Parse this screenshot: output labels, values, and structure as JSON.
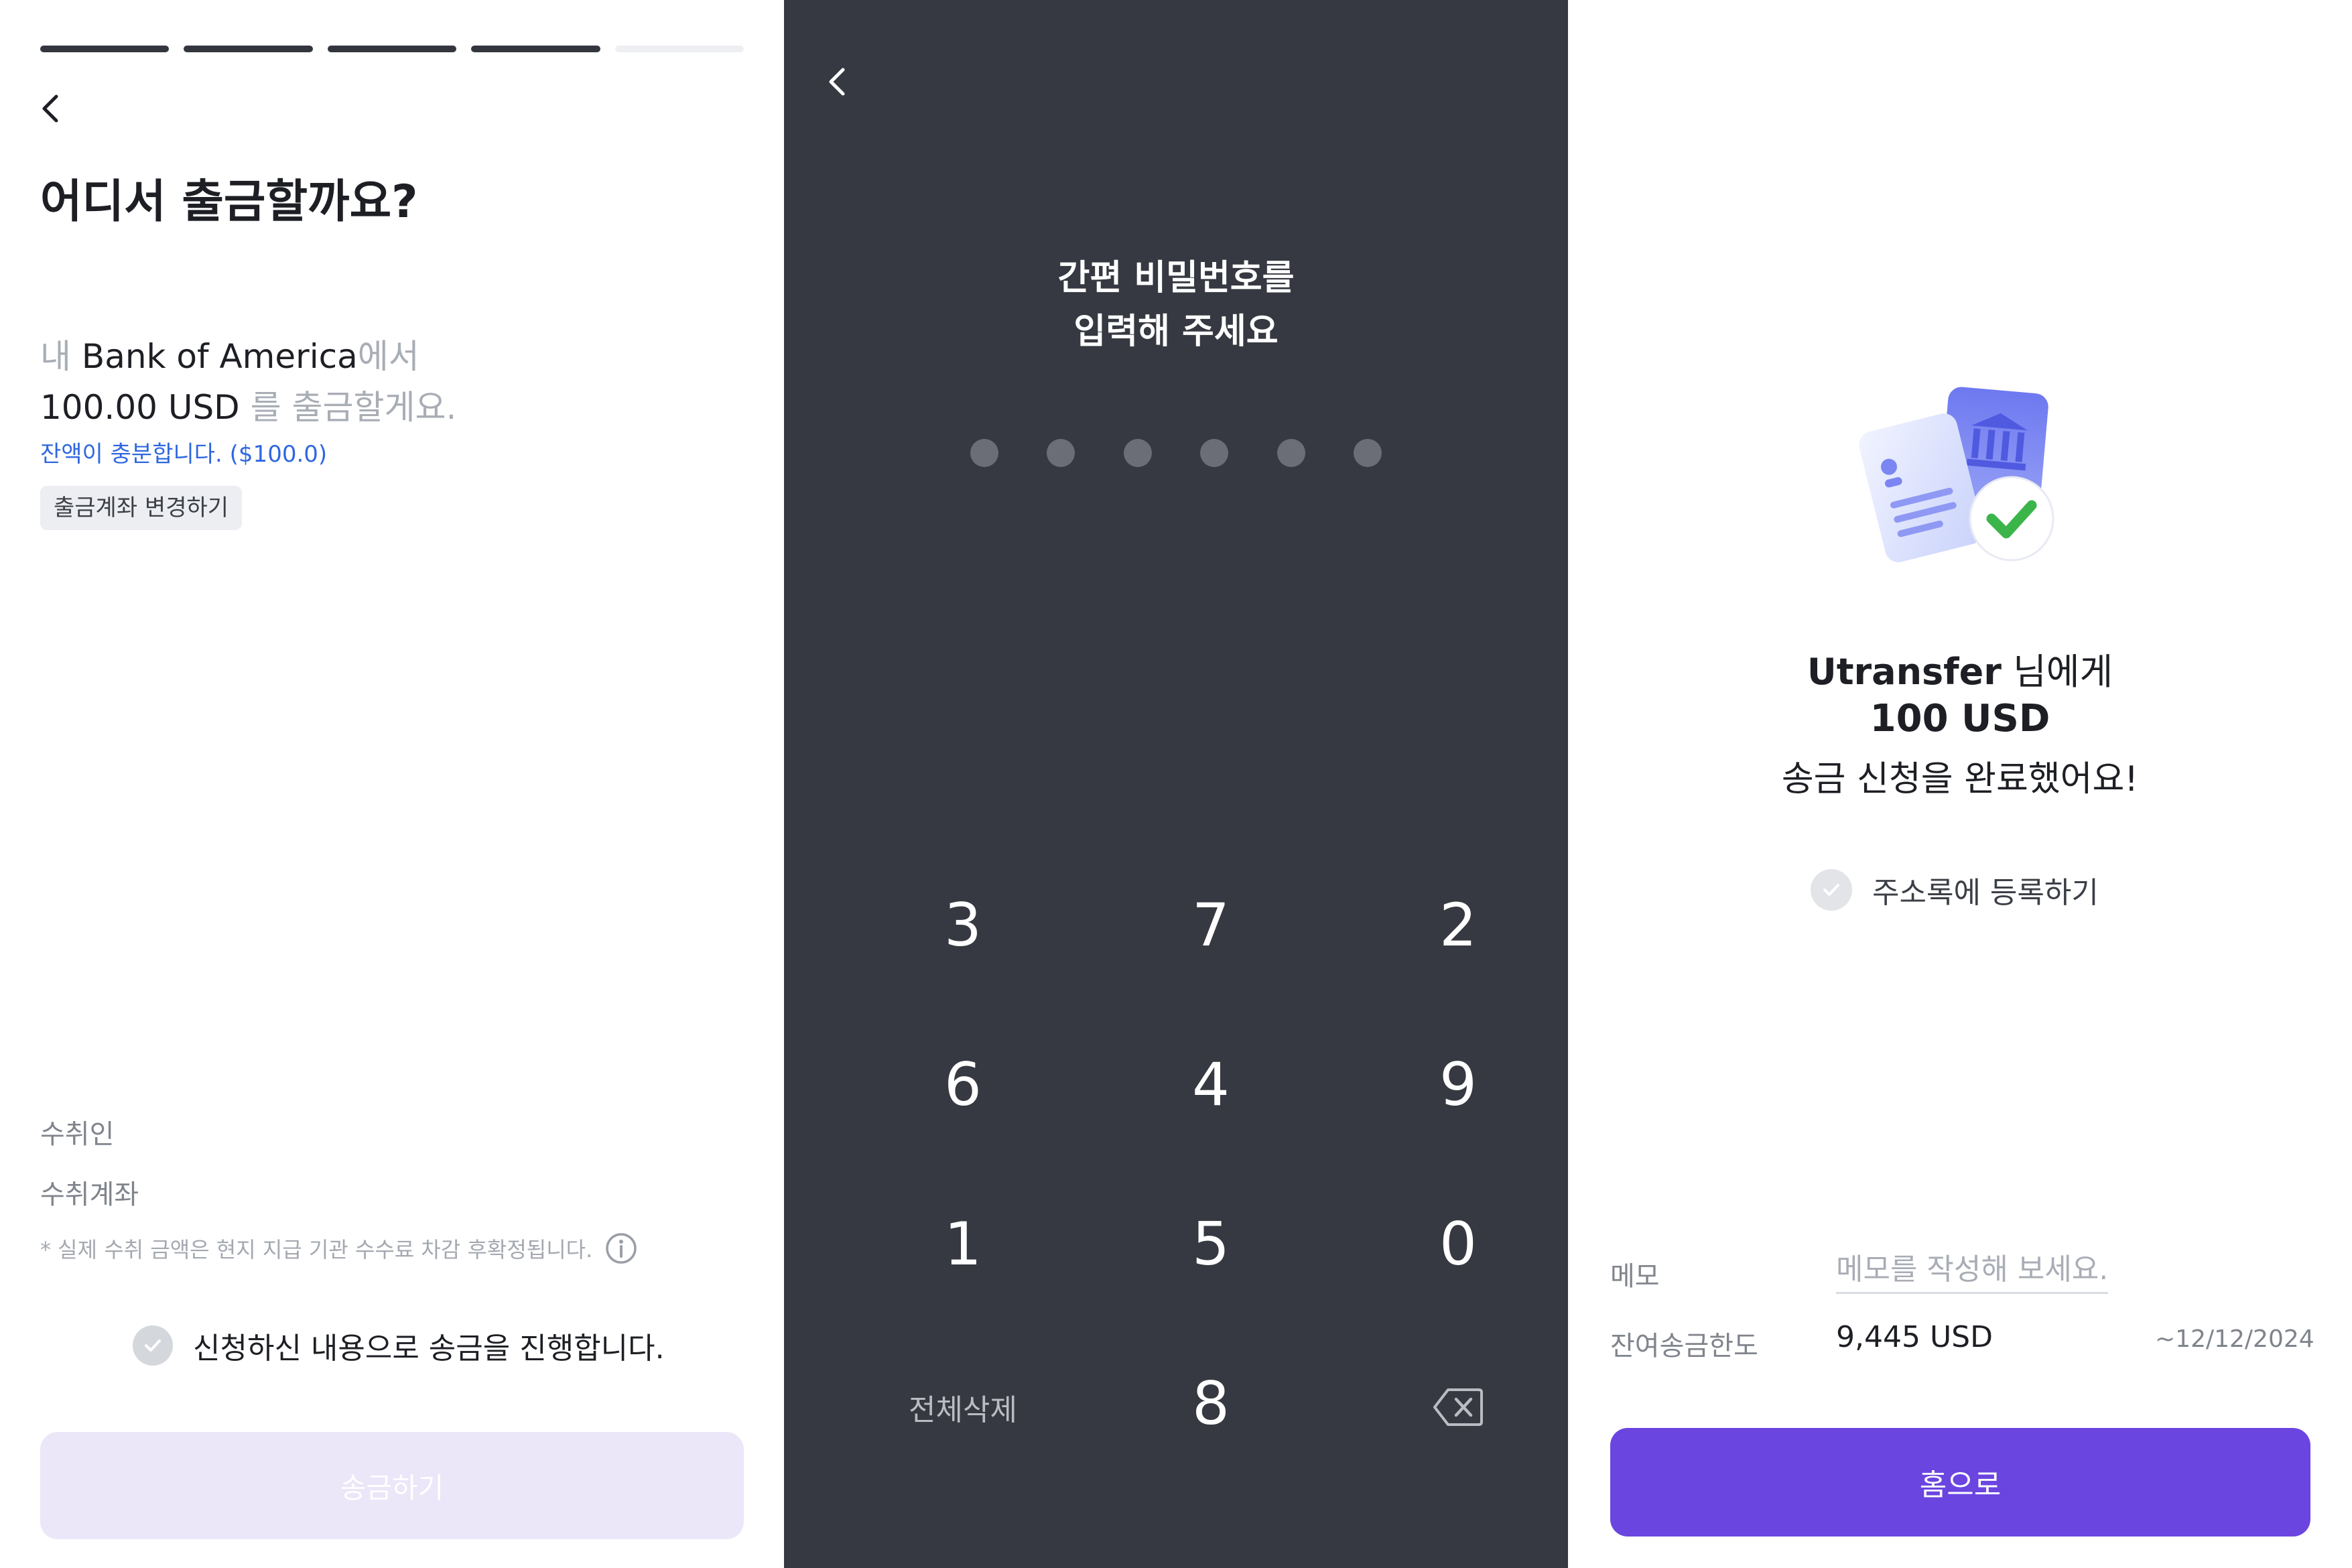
{
  "withdraw": {
    "progress": [
      true,
      true,
      true,
      true,
      false
    ],
    "title": "어디서 출금할까요?",
    "line1_prefix": "내 ",
    "bank": "Bank of America",
    "line1_suffix": "에서",
    "amount": "100.00 USD",
    "line2_suffix": " 를 출금할게요.",
    "balance_text": "잔액이 충분합니다. ($100.0)",
    "change_account": "출금계좌 변경하기",
    "recipient_label": "수취인",
    "recipient_account_label": "수취계좌",
    "note": "* 실제 수취 금액은 현지 지급 기관 수수료 차감 후확정됩니다.",
    "confirm_text": "신청하신 내용으로 송금을 진행합니다.",
    "send_button": "송금하기"
  },
  "pin": {
    "title_line1": "간편 비밀번호를",
    "title_line2": "입력해 주세요",
    "dot_count": 6,
    "keys": [
      "3",
      "7",
      "2",
      "6",
      "4",
      "9",
      "1",
      "5",
      "0",
      "8"
    ],
    "clear_all": "전체삭제"
  },
  "success": {
    "recipient_name": "Utransfer",
    "recipient_suffix": " 님에게",
    "amount": "100 USD",
    "message": "송금 신청을 완료했어요!",
    "register_label": "주소록에 등록하기",
    "memo_label": "메모",
    "memo_placeholder": "메모를 작성해 보세요.",
    "limit_label": "잔여송금한도",
    "limit_value": "9,445 USD",
    "limit_date": "~12/12/2024",
    "home_button": "홈으로"
  },
  "colors": {
    "accent": "#6b45e0",
    "disabled_button": "#ebe6f8",
    "keypad_bg": "#363941",
    "success_check": "#3bb54a",
    "balance_ok": "#2f67e0"
  }
}
